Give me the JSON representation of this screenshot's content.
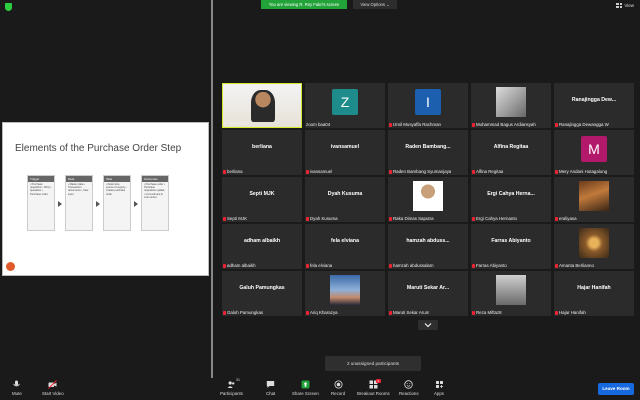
{
  "top": {
    "viewing_banner": "You are viewing R. Rey Fakri's screen",
    "view_options": "View Options ⌄",
    "view_label": "View"
  },
  "slide": {
    "title": "Elements of the Purchase Order Step",
    "steps": [
      {
        "head": "Trigger",
        "body": "• Purchase requisition • RFQ • Quotation • Purchase order"
      },
      {
        "head": "Data",
        "body": "• Master data • Transaction documents • User input"
      },
      {
        "head": "Task",
        "body": "• Determine source of supply • Create purchase order"
      },
      {
        "head": "Outcomes",
        "body": "• Purchase order • Purchase requisition update • Commitment in cost center"
      }
    ]
  },
  "tiles": [
    {
      "big": "",
      "label": "R. Rey Fakri...",
      "kind": "video",
      "muted": false
    },
    {
      "big": "",
      "label": "zoom baa04",
      "kind": "letter",
      "letter": "Z",
      "color": "#1f8c8c",
      "muted": false
    },
    {
      "big": "",
      "label": "Izmil Musyaffa Rachman",
      "kind": "letter",
      "letter": "I",
      "color": "#1c5fae",
      "muted": true
    },
    {
      "big": "",
      "label": "Muhammad Bagus Ardiansyah",
      "kind": "photo",
      "photo": "horse",
      "muted": true
    },
    {
      "big": "Ranajingga Dew...",
      "label": "Ranajingga Dewangga W",
      "kind": "name",
      "muted": true
    },
    {
      "big": "berliana",
      "label": "berliana",
      "kind": "name",
      "muted": true
    },
    {
      "big": "ivansamuel",
      "label": "ivansamuel",
      "kind": "name",
      "muted": true
    },
    {
      "big": "Raden Bambang...",
      "label": "Raden Bambang Syumanjaya",
      "kind": "name",
      "muted": true
    },
    {
      "big": "Alfina Regitaa",
      "label": "Alfina Regitaa",
      "kind": "name",
      "muted": true
    },
    {
      "big": "",
      "label": "Mery Andani Hutagalung",
      "kind": "letter",
      "letter": "M",
      "color": "#b3196b",
      "muted": true
    },
    {
      "big": "Septi MJK",
      "label": "Septi MJK",
      "kind": "name",
      "muted": true
    },
    {
      "big": "Dyah Kusuma",
      "label": "Dyah Kusuma",
      "kind": "name",
      "muted": true
    },
    {
      "big": "",
      "label": "Raka Dimas Saputra",
      "kind": "photo",
      "photo": "person",
      "muted": true
    },
    {
      "big": "Ergi Cahya Herna...",
      "label": "Ergi Cahya Hernanto",
      "kind": "name",
      "muted": true
    },
    {
      "big": "",
      "label": "eraliyasa",
      "kind": "photo",
      "photo": "art",
      "muted": true
    },
    {
      "big": "adham albaikh",
      "label": "adham albaikh",
      "kind": "name",
      "muted": true
    },
    {
      "big": "fela elviana",
      "label": "fela elviana",
      "kind": "name",
      "muted": true
    },
    {
      "big": "hamzah abduss...",
      "label": "hamzah abdussalam",
      "kind": "name",
      "muted": true
    },
    {
      "big": "Farras Abiyanto",
      "label": "Farras Abiyanto",
      "kind": "name",
      "muted": true
    },
    {
      "big": "",
      "label": "Amanta Berlianno",
      "kind": "photo",
      "photo": "warm",
      "muted": true
    },
    {
      "big": "Galuh Pamungkas",
      "label": "Galuh Pamungkas",
      "kind": "name",
      "muted": true
    },
    {
      "big": "",
      "label": "Ariq Kharazya",
      "kind": "photo",
      "photo": "sky",
      "muted": true
    },
    {
      "big": "Maruti Sekar Ar...",
      "label": "Maruti Sekar Arum",
      "kind": "name",
      "muted": true
    },
    {
      "big": "",
      "label": "Reza Miftaz8",
      "kind": "photo",
      "photo": "gray",
      "muted": true
    },
    {
      "big": "Hajar Hanifah",
      "label": "Hajar Hanifah",
      "kind": "name",
      "muted": true
    }
  ],
  "unassigned": "2 unassigned participants",
  "toolbar": {
    "mute": "Mute",
    "start_video": "Start Video",
    "participants": "Participants",
    "participants_count": "31",
    "chat": "Chat",
    "share_screen": "Share Screen",
    "record": "Record",
    "breakout": "Breakout Rooms",
    "breakout_count": "2",
    "reactions": "Reactions",
    "apps": "Apps",
    "leave": "Leave Room"
  },
  "colors": {
    "share_green": "#22a33a",
    "leave_blue": "#1769e0",
    "active_speaker": "#d4e82a",
    "muted_red": "#e22233"
  }
}
